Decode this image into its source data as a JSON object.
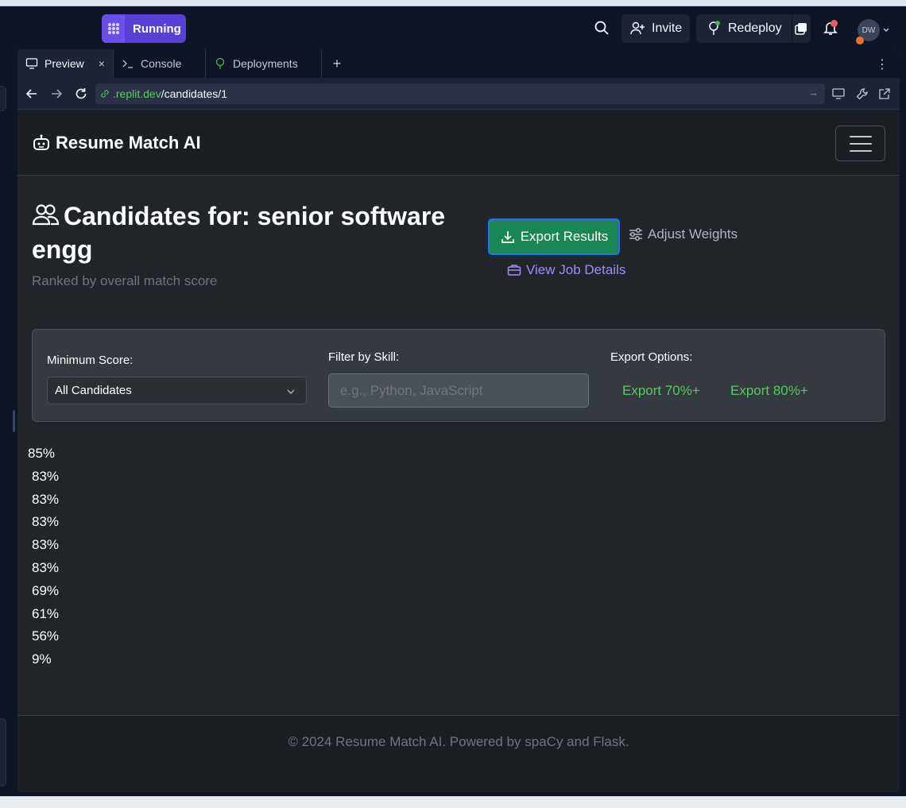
{
  "replit": {
    "run_label": "Running",
    "invite_label": "Invite",
    "redeploy_label": "Redeploy",
    "avatar_initials": "DW",
    "tabs": [
      {
        "label": "Preview",
        "close": "×"
      },
      {
        "label": "Console"
      },
      {
        "label": "Deployments"
      }
    ],
    "add_tab": "+",
    "more": "⋮",
    "url": {
      "host": ".replit.dev",
      "path": "/candidates/1"
    }
  },
  "app": {
    "brand": "Resume Match AI",
    "page_title": "Candidates for: senior software engg",
    "subtitle": "Ranked by overall match score",
    "export_button": "Export Results",
    "weights_button": "Adjust Weights",
    "job_link": "View Job Details",
    "filters": {
      "min_score_label": "Minimum Score:",
      "min_score_value": "All Candidates",
      "skill_label": "Filter by Skill:",
      "skill_placeholder": "e.g., Python, JavaScript",
      "export_options_label": "Export Options:",
      "export_70": "Export 70%+",
      "export_80": "Export 80%+"
    },
    "scores": [
      "85%",
      "83%",
      "83%",
      "83%",
      "83%",
      "83%",
      "69%",
      "61%",
      "56%",
      "9%"
    ],
    "footer": "© 2024 Resume Match AI. Powered by spaCy and Flask."
  },
  "colors": {
    "accent_purple": "#5a3fd6",
    "success_green": "#198754",
    "link_green": "#58c965",
    "link_purple": "#a18bfa"
  }
}
